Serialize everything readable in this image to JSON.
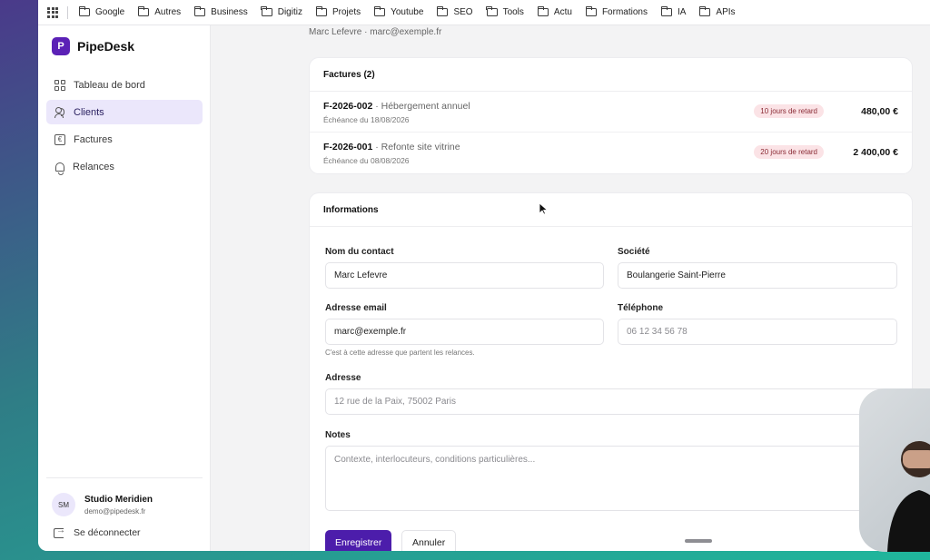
{
  "bookmarks": [
    "Google",
    "Autres",
    "Business",
    "Digitiz",
    "Projets",
    "Youtube",
    "SEO",
    "Tools",
    "Actu",
    "Formations",
    "IA",
    "APIs"
  ],
  "app": {
    "logo_letter": "P",
    "name": "PipeDesk"
  },
  "nav": [
    {
      "label": "Tableau de bord",
      "icon": "dashboard-grid-icon"
    },
    {
      "label": "Clients",
      "icon": "users-icon",
      "active": true
    },
    {
      "label": "Factures",
      "icon": "invoice-icon"
    },
    {
      "label": "Relances",
      "icon": "bell-icon"
    }
  ],
  "user": {
    "initials": "SM",
    "name": "Studio Meridien",
    "email": "demo@pipedesk.fr"
  },
  "logout_label": "Se déconnecter",
  "header": {
    "contact_line": "Marc Lefevre · marc@exemple.fr"
  },
  "invoices": {
    "title": "Factures (2)",
    "rows": [
      {
        "number": "F-2026-002",
        "description": " · Hébergement annuel",
        "due": "Échéance du 18/08/2026",
        "badge": "10 jours de retard",
        "amount": "480,00 €"
      },
      {
        "number": "F-2026-001",
        "description": " · Refonte site vitrine",
        "due": "Échéance du 08/08/2026",
        "badge": "20 jours de retard",
        "amount": "2 400,00 €"
      }
    ]
  },
  "info": {
    "title": "Informations",
    "contact_label": "Nom du contact",
    "contact_value": "Marc Lefevre",
    "company_label": "Société",
    "company_value": "Boulangerie Saint-Pierre",
    "email_label": "Adresse email",
    "email_value": "marc@exemple.fr",
    "email_hint": "C'est à cette adresse que partent les relances.",
    "phone_label": "Téléphone",
    "phone_value": "06 12 34 56 78",
    "address_label": "Adresse",
    "address_value": "12 rue de la Paix, 75002 Paris",
    "notes_label": "Notes",
    "notes_placeholder": "Contexte, interlocuteurs, conditions particulières..."
  },
  "actions": {
    "save_label": "Enregistrer",
    "cancel_label": "Annuler"
  },
  "colors": {
    "accent": "#4c1dab",
    "active_nav_bg": "#ebe7fb",
    "badge_bg": "#fbe3e6"
  }
}
